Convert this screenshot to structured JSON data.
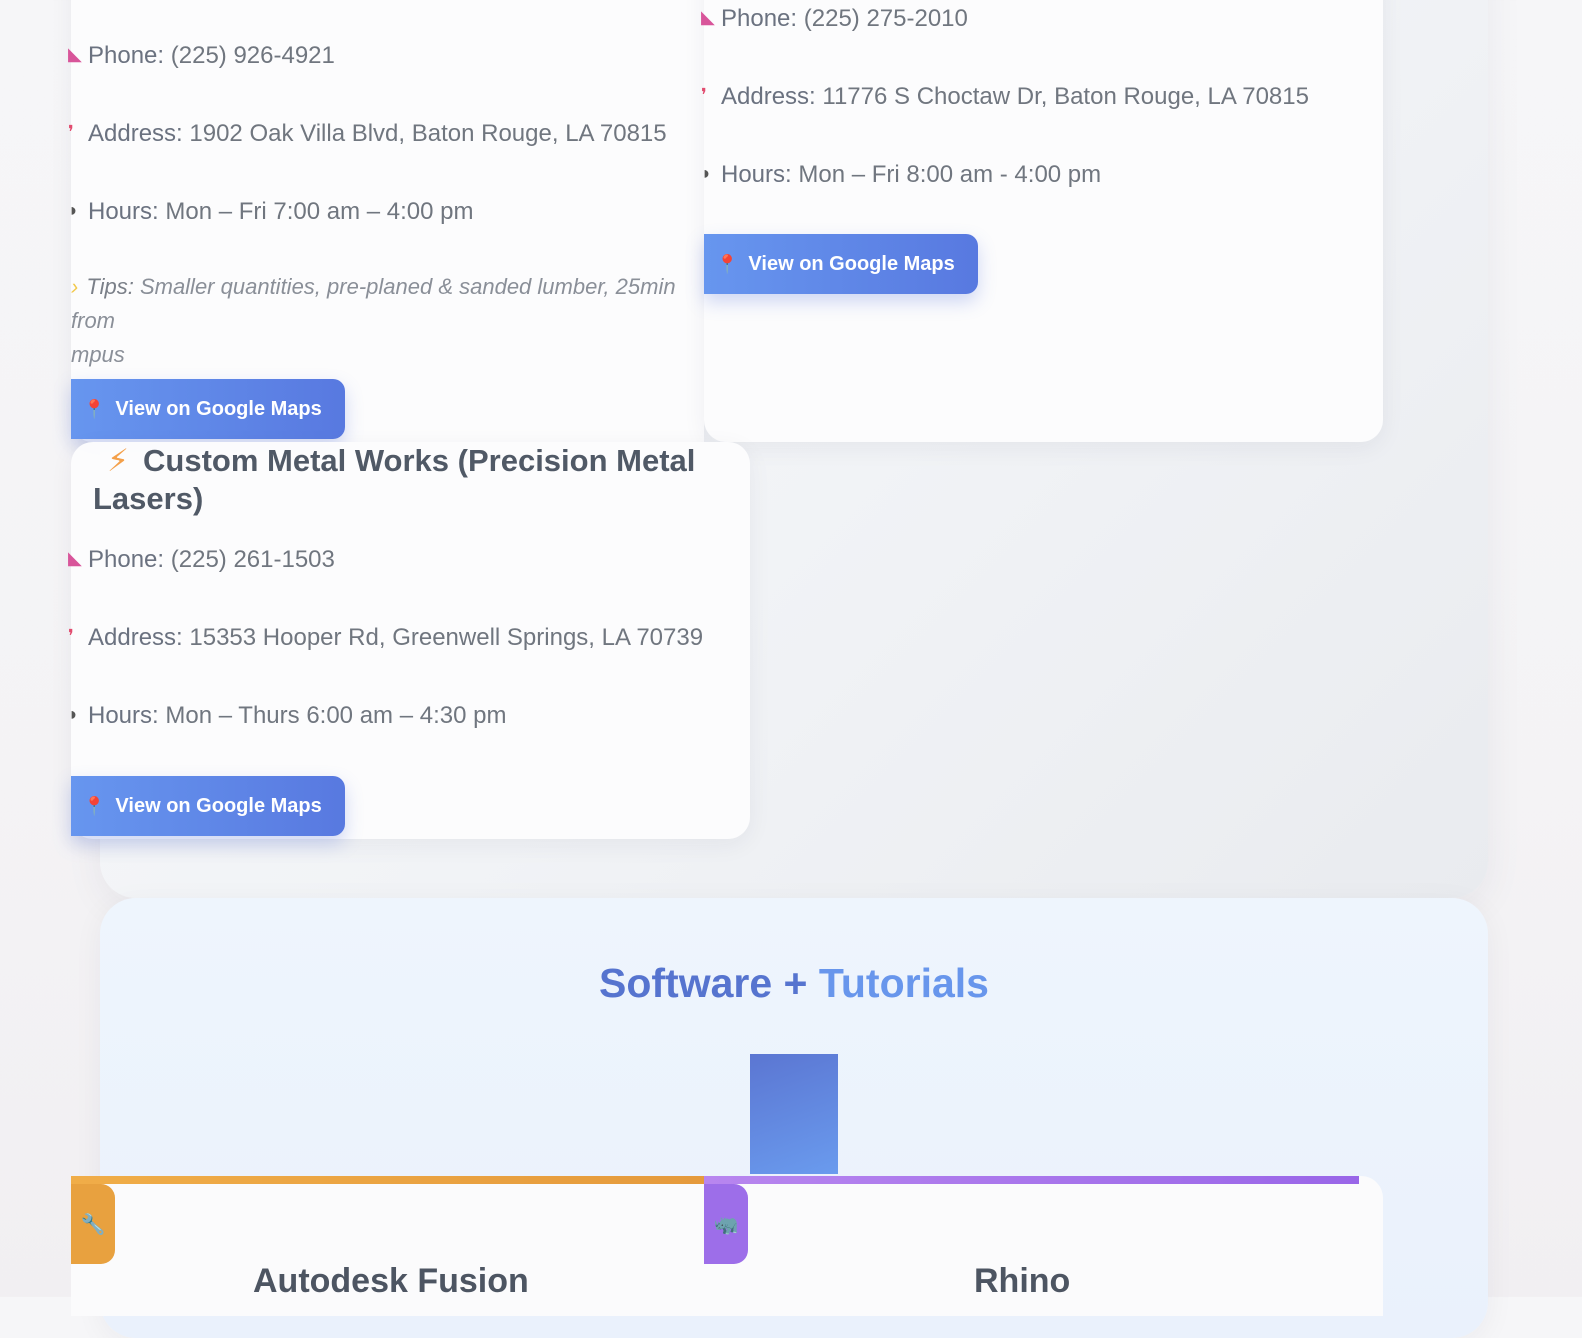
{
  "locations": [
    {
      "phone_label": "Phone:",
      "phone": "(225) 926-4921",
      "address_label": "Address:",
      "address": "1902 Oak Villa Blvd, Baton Rouge, LA 70815",
      "hours_label": "Hours:",
      "hours": "Mon – Fri 7:00 am – 4:00 pm",
      "tips_label": "Tips:",
      "tips": "Smaller quantities, pre-planed & sanded lumber, 25min from",
      "tips_cont": "mpus",
      "button": "View on Google Maps"
    },
    {
      "phone_label": "Phone:",
      "phone": "(225) 275-2010",
      "address_label": "Address:",
      "address": "11776 S Choctaw Dr, Baton Rouge, LA 70815",
      "hours_label": "Hours:",
      "hours": "Mon – Fri 8:00 am - 4:00 pm",
      "button": "View on Google Maps"
    },
    {
      "title": "Custom Metal Works (Precision Metal Lasers)",
      "title_icon": "lightning-bolt-icon",
      "phone_label": "Phone:",
      "phone": "(225) 261-1503",
      "address_label": "Address:",
      "address": "15353 Hooper Rd, Greenwell Springs, LA 70739",
      "hours_label": "Hours:",
      "hours": "Mon – Thurs 6:00 am – 4:30 pm",
      "button": "View on Google Maps"
    }
  ],
  "software_section": {
    "title_part1": "Software +",
    "title_part2": "Tutorials",
    "cards": [
      {
        "name": "Autodesk Fusion",
        "icon": "wrench-icon",
        "accent": "#e8a13f"
      },
      {
        "name": "Rhino",
        "icon": "rhino-icon",
        "accent": "#9d6ee9"
      }
    ]
  },
  "colors": {
    "button_start": "#6796ef",
    "button_end": "#5879e0",
    "title_blue": "#5674cf",
    "title_light_blue": "#6896ec"
  }
}
